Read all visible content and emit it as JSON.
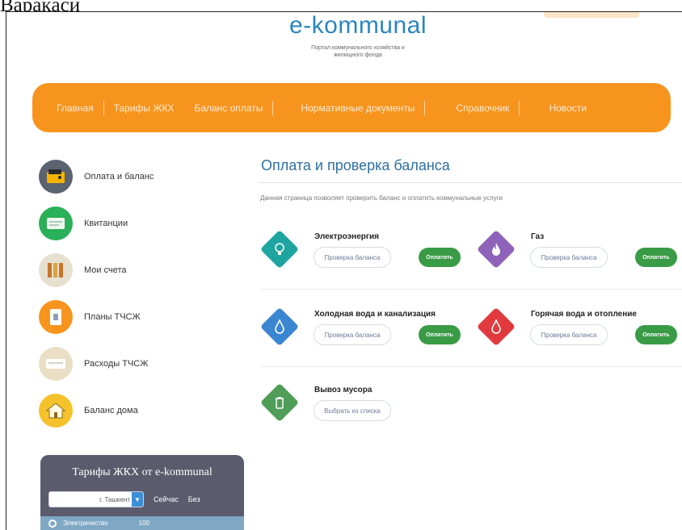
{
  "page_header": {
    "top_fragment": "Варақаси"
  },
  "brand": {
    "logo": "e-kommunal",
    "subtitle": "Портал коммунального хозяйства и жилищного фонда"
  },
  "nav": {
    "items": [
      {
        "label": "Главная"
      },
      {
        "label": "Тарифы ЖКХ"
      },
      {
        "label": "Баланс оплаты"
      },
      {
        "label": "Нормативные документы"
      },
      {
        "label": "Справочник"
      },
      {
        "label": "Новости"
      }
    ]
  },
  "sidebar": {
    "items": [
      {
        "label": "Оплата и баланс",
        "color": "#5b6270",
        "icon": "wallet-icon"
      },
      {
        "label": "Квитанции",
        "color": "#2bb05a",
        "icon": "receipt-icon"
      },
      {
        "label": "Мои счета",
        "color": "#e6e0cf",
        "icon": "accounts-icon"
      },
      {
        "label": "Планы ТЧСЖ",
        "color": "#f7941d",
        "icon": "document-icon"
      },
      {
        "label": "Расходы ТЧСЖ",
        "color": "#eadfc4",
        "icon": "expenses-icon"
      },
      {
        "label": "Баланс дома",
        "color": "#f5c22b",
        "icon": "house-icon"
      }
    ]
  },
  "tariff_widget": {
    "title": "Тарифы ЖКХ от e-kommunal",
    "city": "г. Ташкент",
    "tabs": [
      "Сейчас",
      "Без"
    ],
    "row_label": "Электричество",
    "row_value": "100"
  },
  "main": {
    "title": "Оплата и проверка баланса",
    "description": "Данная страница позволяет проверить баланс и оплатить коммунальные услуги"
  },
  "services": [
    {
      "name": "Электроэнергия",
      "check_label": "Проверка баланса",
      "pay_label": "Оплатить",
      "color": "#1ea5a0",
      "icon": "lightbulb-icon",
      "glyph": "💡"
    },
    {
      "name": "Газ",
      "check_label": "Проверка баланса",
      "pay_label": "Оплатить",
      "color": "#8e62b8",
      "icon": "flame-icon",
      "glyph": "🔥"
    },
    {
      "name": "Холодная вода и канализация",
      "check_label": "Проверка баланса",
      "pay_label": "Оплатить",
      "color": "#3b86d0",
      "icon": "water-drop-icon",
      "glyph": "💧"
    },
    {
      "name": "Горячая вода и отопление",
      "check_label": "Проверка баланса",
      "pay_label": "Оплатить",
      "color": "#e03a3f",
      "icon": "hot-water-icon",
      "glyph": "💧"
    },
    {
      "name": "Вывоз мусора",
      "check_label": "Выбрать из списка",
      "pay_label": "",
      "color": "#4f9d58",
      "icon": "trash-icon",
      "glyph": "🗑"
    }
  ]
}
